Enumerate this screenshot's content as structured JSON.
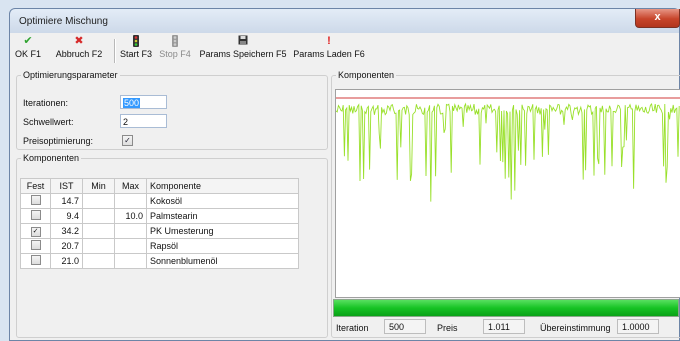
{
  "window": {
    "title": "Optimiere Mischung",
    "close_glyph": "x"
  },
  "toolbar": {
    "ok": {
      "label": "OK F1",
      "icon": "check-icon"
    },
    "cancel": {
      "label": "Abbruch F2",
      "icon": "cross-icon"
    },
    "start": {
      "label": "Start F3",
      "icon": "traffic-light-icon"
    },
    "stop": {
      "label": "Stop F4",
      "icon": "traffic-light-icon"
    },
    "save": {
      "label": "Params Speichern F5",
      "icon": "floppy-disk-icon"
    },
    "load": {
      "label": "Params Laden F6",
      "icon": "exclamation-icon"
    }
  },
  "params": {
    "legend": "Optimierungsparameter",
    "iterations_label": "Iterationen:",
    "iterations_value": "500",
    "threshold_label": "Schwellwert:",
    "threshold_value": "2",
    "price_label": "Preisoptimierung:",
    "price_checked": true
  },
  "components": {
    "legend": "Komponenten",
    "headers": [
      "Fest",
      "IST",
      "Min",
      "Max",
      "Komponente"
    ],
    "rows": [
      {
        "fest": false,
        "ist": "14.7",
        "min": "",
        "max": "",
        "name": "Kokosöl"
      },
      {
        "fest": false,
        "ist": "9.4",
        "min": "",
        "max": "10.0",
        "name": "Palmstearin"
      },
      {
        "fest": true,
        "ist": "34.2",
        "min": "",
        "max": "",
        "name": "PK Umesterung"
      },
      {
        "fest": false,
        "ist": "20.7",
        "min": "",
        "max": "",
        "name": "Rapsöl"
      },
      {
        "fest": false,
        "ist": "21.0",
        "min": "",
        "max": "",
        "name": "Sonnenblumenöl"
      }
    ]
  },
  "plot": {
    "legend": "Komponenten",
    "line_color": "#99e02a",
    "ref_color": "#d23b3b",
    "progress": 1.0
  },
  "stats": {
    "iteration_label": "Iteration",
    "iteration_value": "500",
    "price_label": "Preis",
    "price_value": "1.011",
    "match_label": "Übereinstimmung",
    "match_value": "1.0000"
  }
}
